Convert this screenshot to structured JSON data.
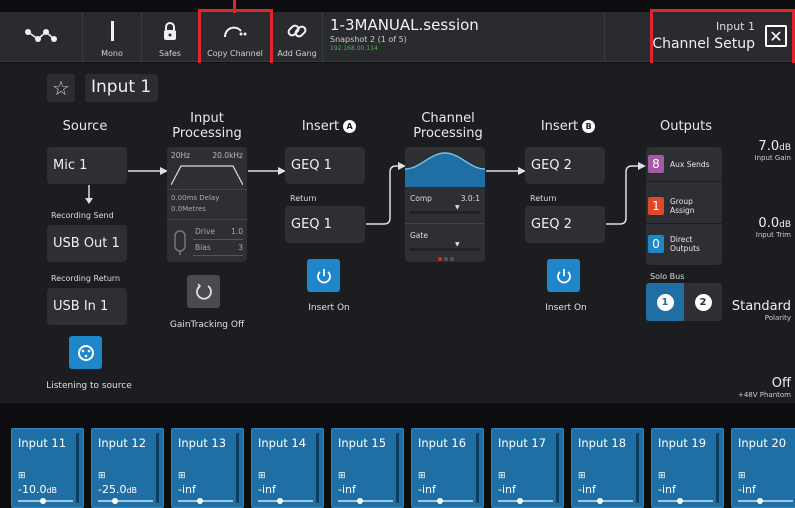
{
  "toolbar": {
    "mono_label": "Mono",
    "safes_label": "Safes",
    "copy_channel_label": "Copy Channel",
    "add_gang_label": "Add Gang"
  },
  "session": {
    "name": "1-3MANUAL.session",
    "snapshot": "Snapshot 2 (1 of 5)",
    "ip": "192.168.00.114"
  },
  "channel_setup": {
    "input": "Input 1",
    "title": "Channel Setup"
  },
  "channel_name": "Input 1",
  "source": {
    "heading": "Source",
    "value": "Mic 1",
    "recording_send_label": "Recording Send",
    "recording_send": "USB Out 1",
    "recording_return_label": "Recording Return",
    "recording_return": "USB In 1",
    "listening_caption": "Listening to source"
  },
  "input_processing": {
    "heading_1": "Input",
    "heading_2": "Processing",
    "hpf": "20Hz",
    "lpf": "20.0kHz",
    "delay": "0.00",
    "delay_unit": "ms Delay",
    "metres": "0.0",
    "metres_unit": "Metres",
    "drive_label": "Drive",
    "drive_value": "1.0",
    "bias_label": "Bias",
    "bias_value": "3",
    "gain_tracking_caption": "GainTracking Off"
  },
  "insert_a": {
    "heading": "Insert",
    "letter": "A",
    "send": "GEQ 1",
    "return_label": "Return",
    "return": "GEQ 1",
    "button_caption": "Insert On"
  },
  "channel_processing": {
    "heading_1": "Channel",
    "heading_2": "Processing",
    "comp_label": "Comp",
    "comp_value": "3.0:1",
    "gate_label": "Gate"
  },
  "insert_b": {
    "heading": "Insert",
    "letter": "B",
    "send": "GEQ 2",
    "return_label": "Return",
    "return": "GEQ 2",
    "button_caption": "Insert On"
  },
  "outputs": {
    "heading": "Outputs",
    "aux_count": "8",
    "aux_label": "Aux Sends",
    "group_count": "1",
    "group_label_1": "Group",
    "group_label_2": "Assign",
    "direct_count": "0",
    "direct_label_1": "Direct",
    "direct_label_2": "Outputs",
    "solo_bus_label": "Solo Bus",
    "solo_1": "1",
    "solo_2": "2",
    "colors": {
      "aux": "#a45aa6",
      "group": "#e0482e",
      "direct": "#1f87c9"
    }
  },
  "right_values": {
    "gain": "7.0",
    "gain_unit": "dB",
    "gain_label": "Input Gain",
    "trim": "0.0",
    "trim_unit": "dB",
    "trim_label": "Input Trim",
    "polarity": "Standard",
    "polarity_label": "Polarity",
    "phantom": "Off",
    "phantom_label": "+48V Phantom"
  },
  "channels": [
    {
      "name": "Input 11",
      "value": "-10.0",
      "unit": "dB",
      "fader": 0.45
    },
    {
      "name": "Input 12",
      "value": "-25.0",
      "unit": "dB",
      "fader": 0.3
    },
    {
      "name": "Input 13",
      "value": "-inf",
      "unit": "",
      "fader": 0.4
    },
    {
      "name": "Input 14",
      "value": "-inf",
      "unit": "",
      "fader": 0.4
    },
    {
      "name": "Input 15",
      "value": "-inf",
      "unit": "",
      "fader": 0.4
    },
    {
      "name": "Input 16",
      "value": "-inf",
      "unit": "",
      "fader": 0.4
    },
    {
      "name": "Input 17",
      "value": "-inf",
      "unit": "",
      "fader": 0.4
    },
    {
      "name": "Input 18",
      "value": "-inf",
      "unit": "",
      "fader": 0.4
    },
    {
      "name": "Input 19",
      "value": "-inf",
      "unit": "",
      "fader": 0.4
    },
    {
      "name": "Input 20",
      "value": "-inf",
      "unit": "",
      "fader": 0.4
    }
  ]
}
